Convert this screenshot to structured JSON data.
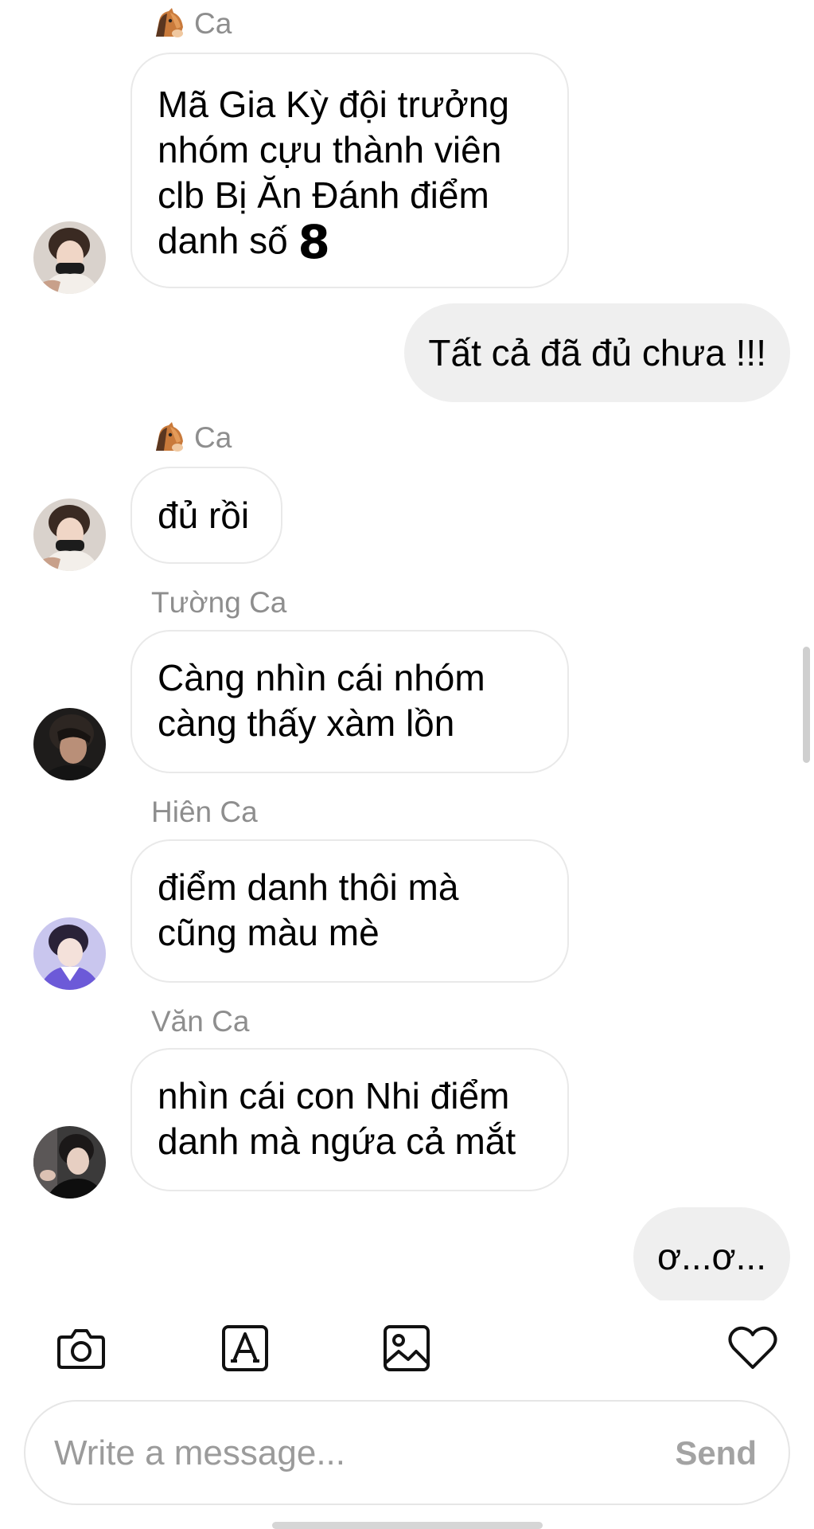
{
  "messages": [
    {
      "sender": "Ca",
      "sender_emoji": "horse-face-emoji",
      "lines": [
        "Mã Gia Kỳ đội trưởng",
        "nhóm cựu thành viên",
        "clb Bị Ăn Đánh điểm",
        "danh số"
      ],
      "emphasis": "8"
    },
    {
      "outgoing": "Tất cả đã đủ chưa !!!"
    },
    {
      "sender": "Ca",
      "sender_emoji": "horse-face-emoji",
      "lines": [
        "đủ rồi"
      ]
    },
    {
      "sender": "Tường Ca",
      "lines": [
        "Càng nhìn cái nhóm",
        "càng thấy xàm lồn"
      ]
    },
    {
      "sender": "Hiên Ca",
      "lines": [
        "điểm danh thôi mà",
        "cũng màu mè"
      ]
    },
    {
      "sender": "Văn Ca",
      "lines": [
        "nhìn cái con Nhi điểm",
        "danh mà ngứa cả mắt"
      ]
    },
    {
      "outgoing": "ơ...ơ..."
    }
  ],
  "toolbar": {
    "icons": [
      "camera-icon",
      "text-style-icon",
      "gallery-icon",
      "heart-icon"
    ]
  },
  "composer": {
    "placeholder": "Write a message...",
    "send_label": "Send"
  },
  "colors": {
    "outgoing_bubble": "#efefef",
    "incoming_border": "#e9e9e9",
    "sender_label": "#8e8e8e",
    "send_button": "#a3a3a3"
  }
}
